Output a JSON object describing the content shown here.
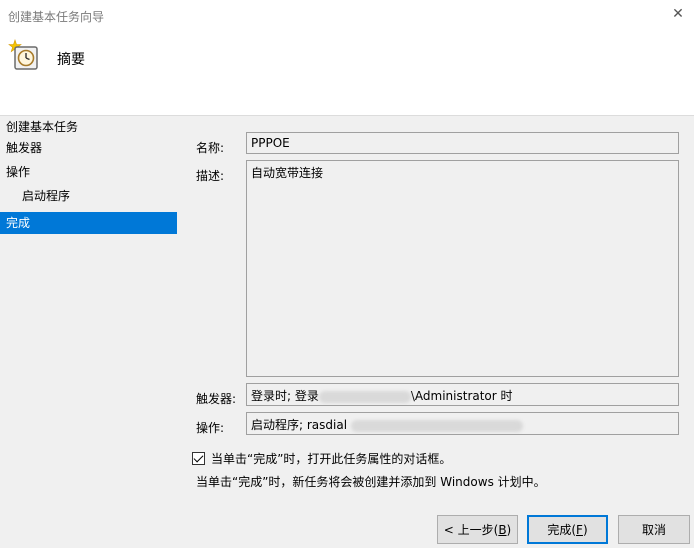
{
  "window": {
    "title": "创建基本任务向导",
    "close_glyph": "✕"
  },
  "header": {
    "title": "摘要"
  },
  "nav": {
    "items": [
      {
        "label": "创建基本任务",
        "sub": false,
        "active": false
      },
      {
        "label": "触发器",
        "sub": false,
        "active": false
      },
      {
        "label": "操作",
        "sub": false,
        "active": false
      },
      {
        "label": "启动程序",
        "sub": true,
        "active": false
      },
      {
        "label": "完成",
        "sub": false,
        "active": true
      }
    ]
  },
  "form": {
    "name_label": "名称:",
    "name_value": "PPPOE",
    "desc_label": "描述:",
    "desc_value": "自动宽带连接",
    "trigger_label": "触发器:",
    "trigger_prefix": "登录时; 登录",
    "trigger_suffix": "\\Administrator 时",
    "action_label": "操作:",
    "action_prefix": "启动程序; rasdial"
  },
  "checkbox": {
    "label": "当单击“完成”时，打开此任务属性的对话框。",
    "checked": true
  },
  "note": "当单击“完成”时，新任务将会被创建并添加到 Windows 计划中。",
  "buttons": {
    "back_prefix": "< 上一步(",
    "back_key": "B",
    "back_suffix": ")",
    "finish_prefix": "完成(",
    "finish_key": "F",
    "finish_suffix": ")",
    "cancel": "取消"
  },
  "colors": {
    "accent": "#0078d7",
    "field_border": "#a0a0a0"
  }
}
